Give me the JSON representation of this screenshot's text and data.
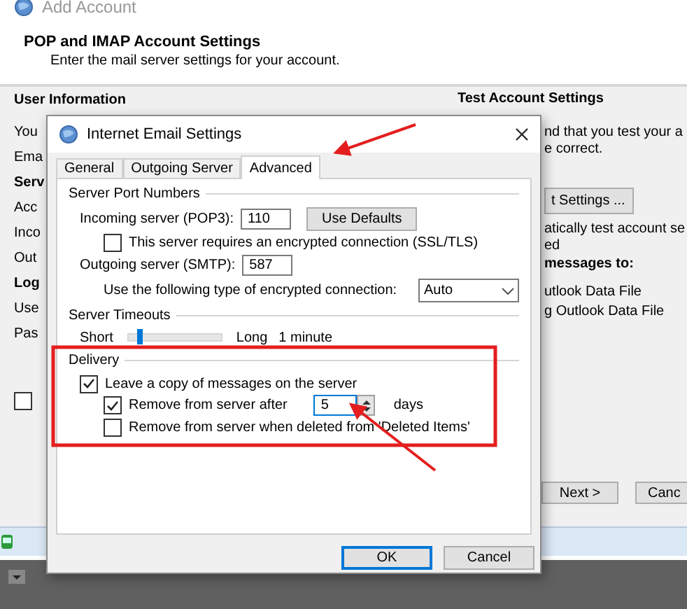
{
  "window": {
    "title": "Add Account"
  },
  "header": {
    "title": "POP and IMAP Account Settings",
    "subtitle": "Enter the mail server settings for your account."
  },
  "left_column": [
    {
      "kind": "heading",
      "text": "User Information"
    },
    {
      "kind": "label",
      "text": "You"
    },
    {
      "kind": "label",
      "text": "Ema"
    },
    {
      "kind": "heading",
      "text": "Serv"
    },
    {
      "kind": "label",
      "text": "Acc"
    },
    {
      "kind": "label",
      "text": "Inco"
    },
    {
      "kind": "label",
      "text": "Out"
    },
    {
      "kind": "heading",
      "text": "Log"
    },
    {
      "kind": "label",
      "text": "Use"
    },
    {
      "kind": "label",
      "text": "Pas"
    }
  ],
  "left_checkbox": {
    "checked": false
  },
  "right_column": [
    {
      "kind": "heading",
      "text": "Test Account Settings"
    },
    {
      "kind": "text",
      "text": "nd that you test your a"
    },
    {
      "kind": "text",
      "text": "e correct."
    },
    {
      "kind": "button",
      "text": "t Settings ..."
    },
    {
      "kind": "text",
      "text": "atically test account se"
    },
    {
      "kind": "text",
      "text": "ed"
    },
    {
      "kind": "heading",
      "text": "messages to:"
    },
    {
      "kind": "text",
      "text": "utlook Data File"
    },
    {
      "kind": "text",
      "text": "g Outlook Data File"
    }
  ],
  "footer_buttons": [
    "Next >",
    "Canc"
  ],
  "dialog": {
    "title": "Internet Email Settings",
    "tabs": [
      {
        "label": "General",
        "selected": false
      },
      {
        "label": "Outgoing Server",
        "selected": false
      },
      {
        "label": "Advanced",
        "selected": true
      }
    ],
    "server_ports": {
      "heading": "Server Port Numbers",
      "incoming_label": "Incoming server (POP3):",
      "incoming_value": "110",
      "defaults_button": "Use Defaults",
      "ssl_label": "This server requires an encrypted connection (SSL/TLS)",
      "ssl_checked": false,
      "outgoing_label": "Outgoing server (SMTP):",
      "outgoing_value": "587",
      "encryption_label": "Use the following type of encrypted connection:",
      "encryption_value": "Auto"
    },
    "timeouts": {
      "heading": "Server Timeouts",
      "short": "Short",
      "long": "Long",
      "level": 0.12,
      "reading": "1 minute"
    },
    "delivery": {
      "heading": "Delivery",
      "leave_copy": {
        "label": "Leave a copy of messages on the server",
        "checked": true
      },
      "remove_after": {
        "label": "Remove from server after",
        "checked": true,
        "value": "5",
        "unit": "days"
      },
      "remove_deleted": {
        "label": "Remove from server when deleted from 'Deleted Items'",
        "checked": false
      }
    },
    "buttons": [
      "OK",
      "Cancel"
    ]
  }
}
